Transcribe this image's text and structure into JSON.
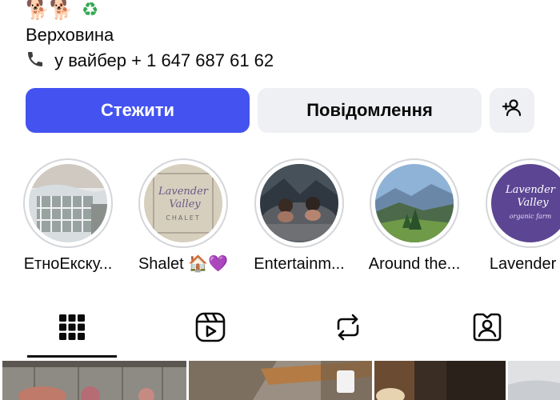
{
  "profile": {
    "emoji_dogs": "🐕🐕",
    "emoji_recycle": "♻",
    "location": "Верховина",
    "phone_icon": "phone-icon",
    "phone_line": "у вайбер + 1 647 687 61 62"
  },
  "actions": {
    "follow_label": "Стежити",
    "message_label": "Повідомлення",
    "add_user_icon": "add-user-icon"
  },
  "highlights": [
    {
      "label": "ЕтноЕкску..."
    },
    {
      "label": "Shalet 🏠💜"
    },
    {
      "label": "Entertainm..."
    },
    {
      "label": "Around the..."
    },
    {
      "label": "Lavender V"
    }
  ],
  "highlight_art": {
    "lavender_text_1": "Lavender",
    "lavender_text_2": "Valley",
    "lavender_text_3": "CHALET",
    "lavender2_text_1": "Lavender",
    "lavender2_text_2": "Valley",
    "lavender2_text_3": "organic farm"
  },
  "tabs": [
    {
      "icon": "grid-icon",
      "active": true
    },
    {
      "icon": "reels-icon",
      "active": false
    },
    {
      "icon": "repost-icon",
      "active": false
    },
    {
      "icon": "tagged-icon",
      "active": false
    }
  ],
  "colors": {
    "primary": "#4453f0",
    "secondary_bg": "#eff0f3",
    "ring": "#d5d6da"
  }
}
